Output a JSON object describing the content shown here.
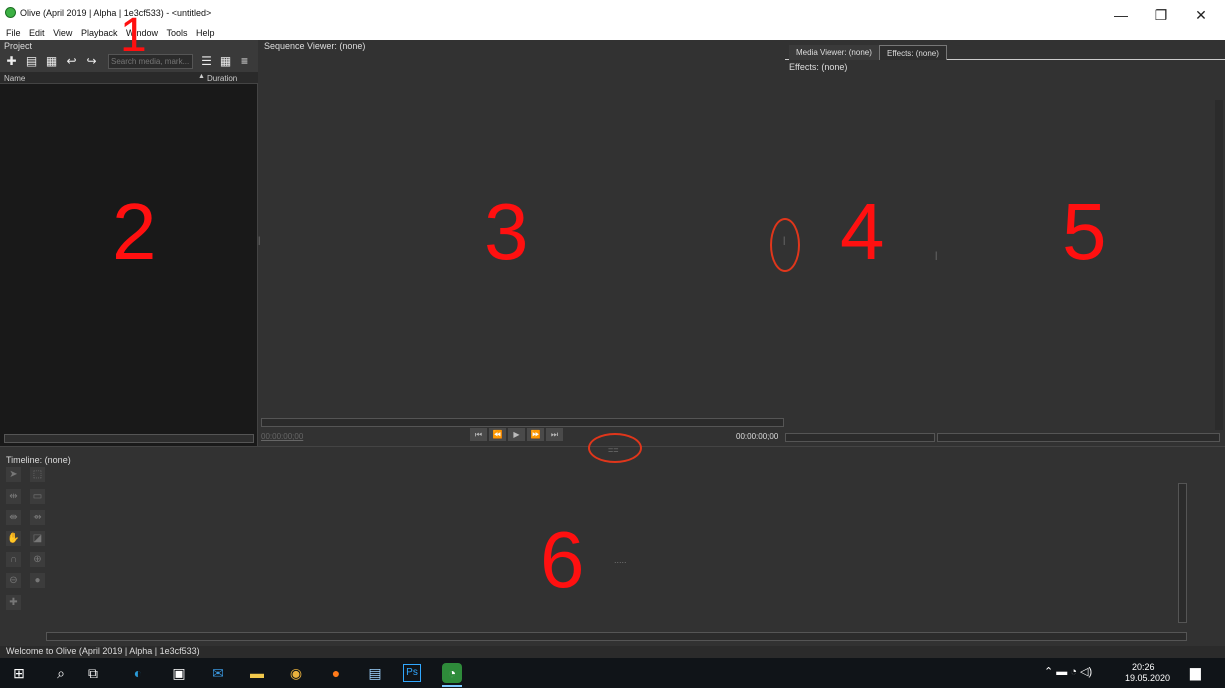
{
  "window": {
    "title": "Olive (April 2019 | Alpha | 1e3cf533) - <untitled>",
    "minimize_glyph": "—",
    "maximize_glyph": "❐",
    "close_glyph": "✕"
  },
  "menubar": {
    "items": [
      "File",
      "Edit",
      "View",
      "Playback",
      "Window",
      "Tools",
      "Help"
    ]
  },
  "project": {
    "header": "Project",
    "search_placeholder": "Search media, mark...",
    "columns": {
      "name": "Name",
      "duration": "Duration"
    }
  },
  "sequence_viewer": {
    "header": "Sequence Viewer: (none)",
    "time_left": "00:00:00;00",
    "time_right": "00:00:00;00"
  },
  "right_panel": {
    "tabs": [
      "Media Viewer: (none)",
      "Effects: (none)"
    ],
    "effects_label": "Effects: (none)"
  },
  "timeline": {
    "header": "Timeline: (none)"
  },
  "statusbar": {
    "text": "Welcome to Olive (April 2019 | Alpha | 1e3cf533)"
  },
  "taskbar": {
    "time": "20:26",
    "date": "19.05.2020"
  },
  "annotations": {
    "n1": "1",
    "n2": "2",
    "n3": "3",
    "n4": "4",
    "n5": "5",
    "n6": "6"
  },
  "colors": {
    "accent_red": "#ff1010",
    "panel_bg": "#323232",
    "project_bg": "#191919"
  },
  "icons": [
    "windows-start-icon",
    "search-icon",
    "task-view-icon",
    "edge-icon",
    "store-icon",
    "mail-icon",
    "file-explorer-icon",
    "chrome-icon",
    "firefox-icon",
    "notes-icon",
    "photoshop-icon",
    "olive-icon"
  ]
}
